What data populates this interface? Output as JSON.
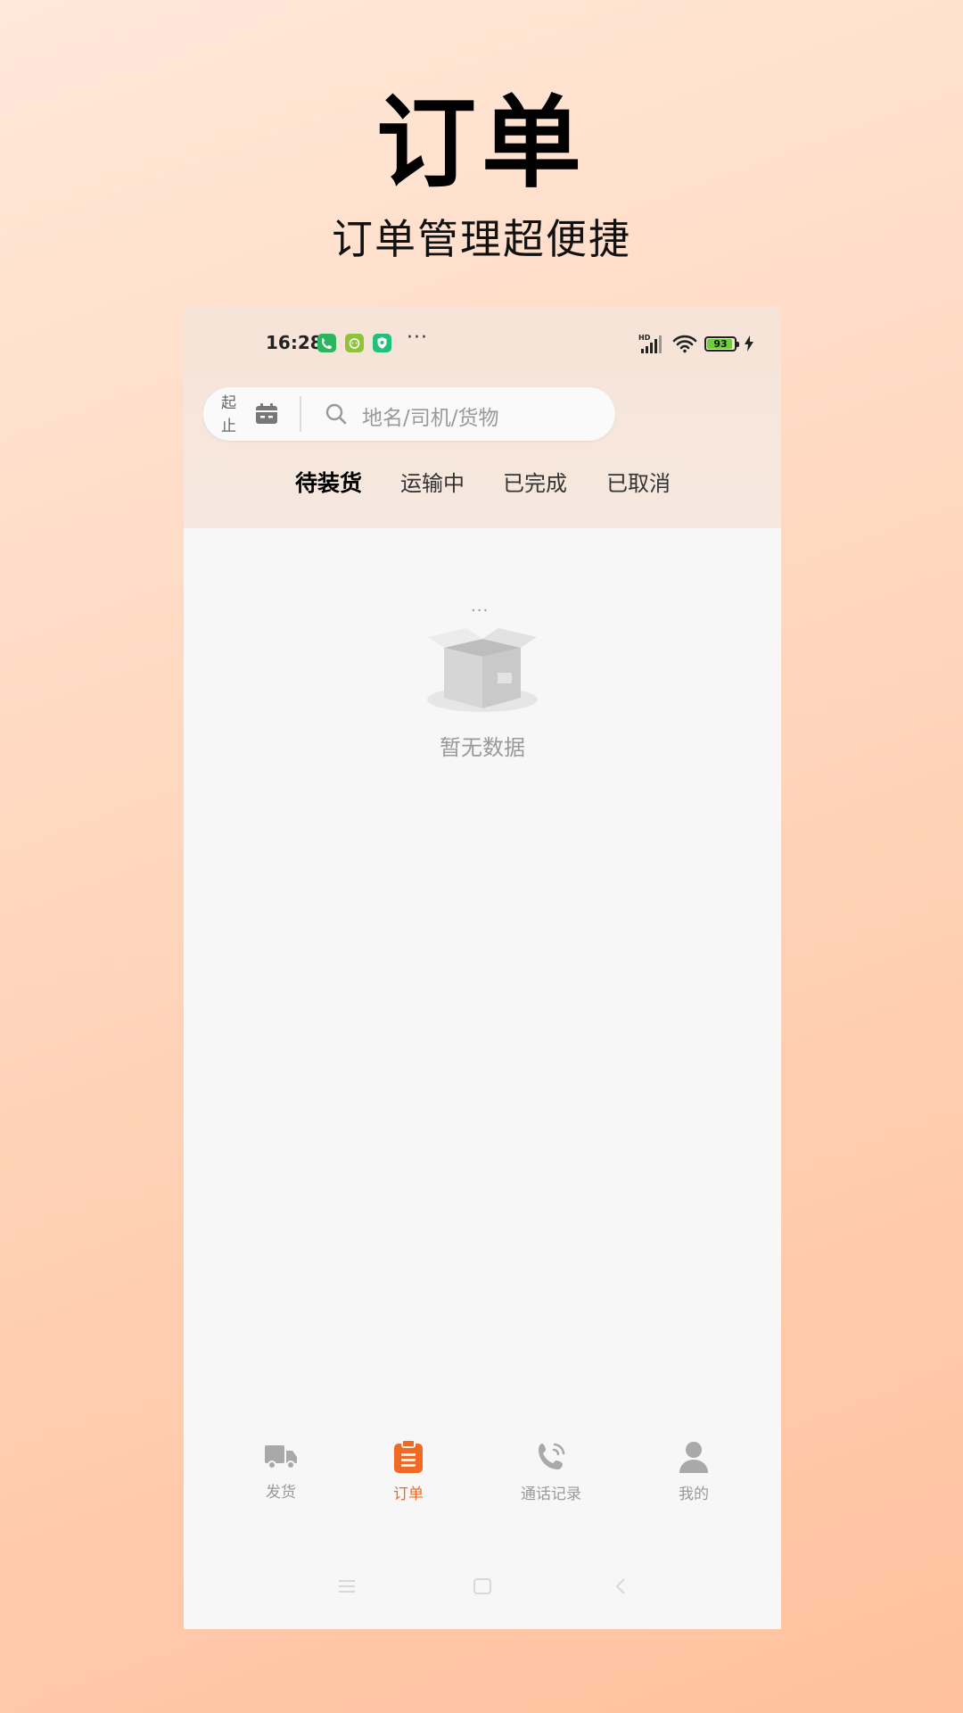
{
  "promo": {
    "title": "订单",
    "subtitle": "订单管理超便捷"
  },
  "status_bar": {
    "time": "16:28",
    "more": "···",
    "network": "HD",
    "battery": "93",
    "battery_level": 0.93,
    "app_icon_colors": [
      "#2bb55e",
      "#8fc43a",
      "#22c17a"
    ]
  },
  "search": {
    "date_range_start": "起",
    "date_range_end": "止",
    "placeholder": "地名/司机/货物"
  },
  "tabs": [
    {
      "label": "待装货",
      "active": true
    },
    {
      "label": "运输中",
      "active": false
    },
    {
      "label": "已完成",
      "active": false
    },
    {
      "label": "已取消",
      "active": false
    }
  ],
  "empty_state": {
    "dots": "···",
    "message": "暂无数据"
  },
  "bottom_nav": [
    {
      "label": "发货",
      "icon": "truck-icon",
      "active": false
    },
    {
      "label": "订单",
      "icon": "clipboard-icon",
      "active": true
    },
    {
      "label": "通话记录",
      "icon": "phone-icon",
      "active": false
    },
    {
      "label": "我的",
      "icon": "user-icon",
      "active": false
    }
  ],
  "colors": {
    "accent": "#f06a26",
    "inactive": "#a9a9a9"
  }
}
